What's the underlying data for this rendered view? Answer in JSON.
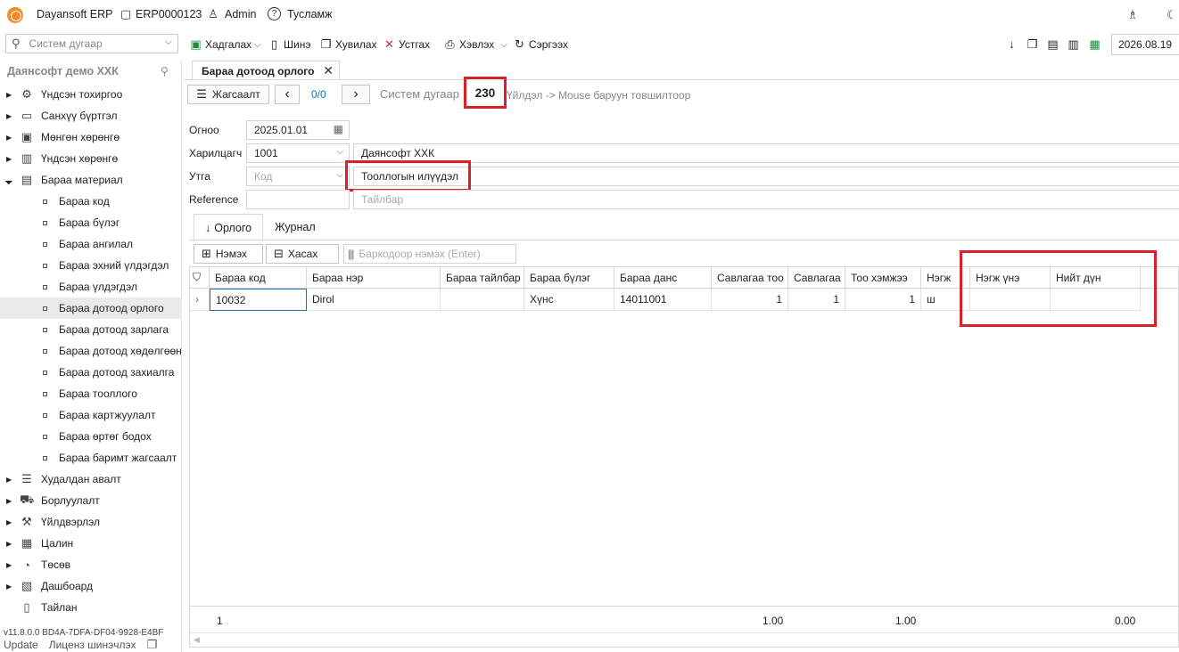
{
  "app": {
    "name": "Dayansoft ERP",
    "db": "ERP0000123",
    "user": "Admin",
    "help": "Тусламж"
  },
  "toolbar": {
    "system_search_placeholder": "Систем дугаар",
    "save": "Хадгалах",
    "new": "Шинэ",
    "copy": "Хувилах",
    "delete": "Устгах",
    "print": "Хэвлэх",
    "refresh": "Сэргээх",
    "date": "2026.08.19"
  },
  "sidebar": {
    "company": "Даянсофт демо ХХК",
    "items": [
      {
        "label": "Үндсэн тохиргоо",
        "icon": "gear-icon",
        "glyph": "⚙"
      },
      {
        "label": "Санхүү бүртгэл",
        "icon": "ledger-icon",
        "glyph": "▭"
      },
      {
        "label": "Мөнгөн хөрөнгө",
        "icon": "cash-icon",
        "glyph": "▣"
      },
      {
        "label": "Үндсэн хөрөнгө",
        "icon": "building-icon",
        "glyph": "▥"
      },
      {
        "label": "Бараа материал",
        "icon": "box-icon",
        "glyph": "▤"
      }
    ],
    "children": [
      "Бараа код",
      "Бараа бүлэг",
      "Бараа ангилал",
      "Бараа эхний үлдэгдэл",
      "Бараа үлдэгдэл",
      "Бараа дотоод орлого",
      "Бараа дотоод зарлага",
      "Бараа дотоод хөдөлгөөн",
      "Бараа дотоод захиалга",
      "Бараа тооллого",
      "Бараа картжуулалт",
      "Бараа өртөг бодох",
      "Бараа баримт жагсаалт"
    ],
    "items_after": [
      {
        "label": "Худалдан авалт",
        "icon": "purchase-icon",
        "glyph": "☰"
      },
      {
        "label": "Борлуулалт",
        "icon": "cart-icon",
        "glyph": "⛟"
      },
      {
        "label": "Үйлдвэрлэл",
        "icon": "factory-icon",
        "glyph": "⚒"
      },
      {
        "label": "Цалин",
        "icon": "salary-icon",
        "glyph": "▦"
      },
      {
        "label": "Төсөв",
        "icon": "budget-icon",
        "glyph": "◔"
      },
      {
        "label": "Дашбоард",
        "icon": "dashboard-icon",
        "glyph": "▧"
      },
      {
        "label": "Тайлан",
        "icon": "report-icon",
        "glyph": "▯"
      }
    ],
    "version": "v11.8.0.0  BD4A-7DFA-DF04-9928-E4BF",
    "update": "Update",
    "license": "Лиценз шинэчлэх"
  },
  "document": {
    "tab_title": "Бараа дотоод орлого",
    "list_button": "Жагсаалт",
    "counter": "0/0",
    "sysnum_label": "Систем дугаар",
    "sysnum_value": "230",
    "hint": "Үйлдэл -> Mouse баруун товшилтоор",
    "fields": {
      "date_label": "Огноо",
      "date_value": "2025.01.01",
      "partner_label": "Харилцагч",
      "partner_code": "1001",
      "partner_name": "Даянсофт ХХК",
      "reason_label": "Утга",
      "reason_code_placeholder": "Код",
      "reason_value": "Тооллогын илүүдэл",
      "reference_label": "Reference",
      "note_placeholder": "Тайлбар"
    },
    "subtabs": [
      "Орлого",
      "Журнал"
    ],
    "grid_buttons": {
      "add": "Нэмэх",
      "remove": "Хасах",
      "barcode_placeholder": "Баркодоор нэмэх (Enter)"
    },
    "grid": {
      "columns": [
        "Бараа код",
        "Бараа нэр",
        "Бараа тайлбар",
        "Бараа бүлэг",
        "Бараа данс",
        "Савлагаа тоо",
        "Савлагаа",
        "Тоо хэмжээ",
        "Нэгж",
        "Нэгж үнэ",
        "Нийт дүн"
      ],
      "rows": [
        [
          "10032",
          "Dirol",
          "",
          "Хүнс",
          "14011001",
          "1",
          "1",
          "1",
          "ш",
          "",
          ""
        ]
      ],
      "summary": {
        "count": "1",
        "pack_qty": "1.00",
        "qty": "1.00",
        "total": "0.00"
      }
    }
  }
}
